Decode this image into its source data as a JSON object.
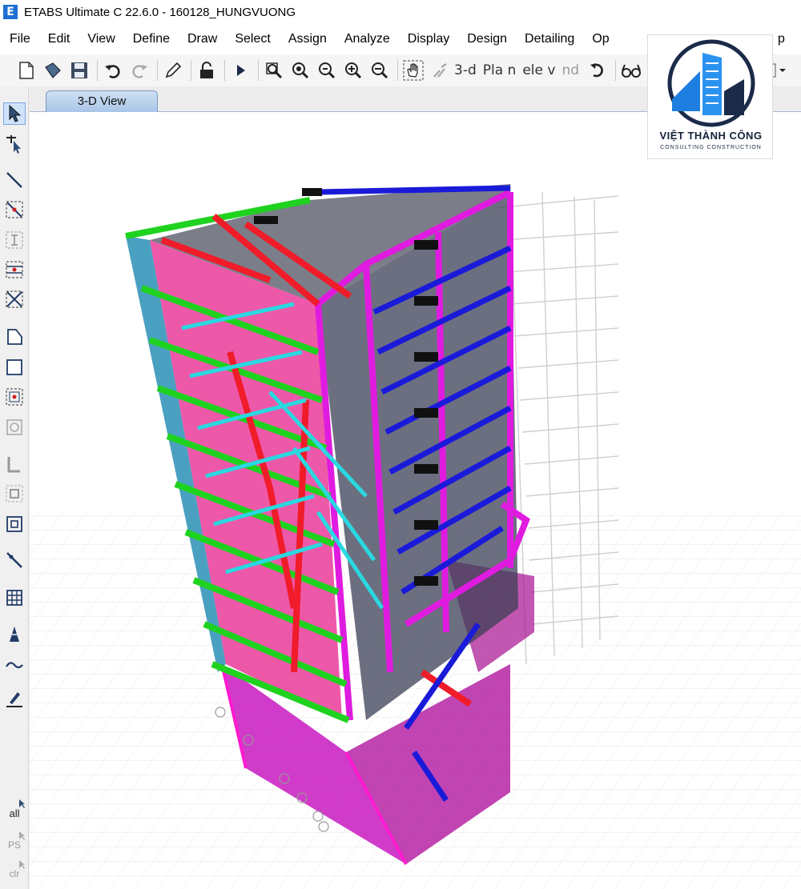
{
  "window": {
    "app_icon_letter": "E",
    "title": "ETABS Ultimate C 22.6.0 - 160128_HUNGVUONG"
  },
  "menu": [
    "File",
    "Edit",
    "View",
    "Define",
    "Draw",
    "Select",
    "Assign",
    "Analyze",
    "Display",
    "Design",
    "Detailing",
    "Op",
    "p"
  ],
  "toolbar": {
    "view_3d": "3-d",
    "plan": "Pla n",
    "elev": "ele v",
    "nd": "nd"
  },
  "left_toolbar": {
    "all": "all",
    "ps": "PS",
    "clr": "clr"
  },
  "tabs": {
    "active": "3-D View"
  },
  "watermark": {
    "name": "VIỆT THÀNH CÔNG",
    "tagline": "CONSULTING CONSTRUCTION",
    "ring_color": "#1b2a49",
    "building_color": "#1f7fe0"
  },
  "colors": {
    "beam_green": "#1fd21f",
    "beam_red": "#f01c2a",
    "beam_blue": "#1a1ad9",
    "wall_magenta": "#e51be0",
    "column_cyan": "#2ad8e0",
    "steel_blue": "#3a9fc8"
  }
}
